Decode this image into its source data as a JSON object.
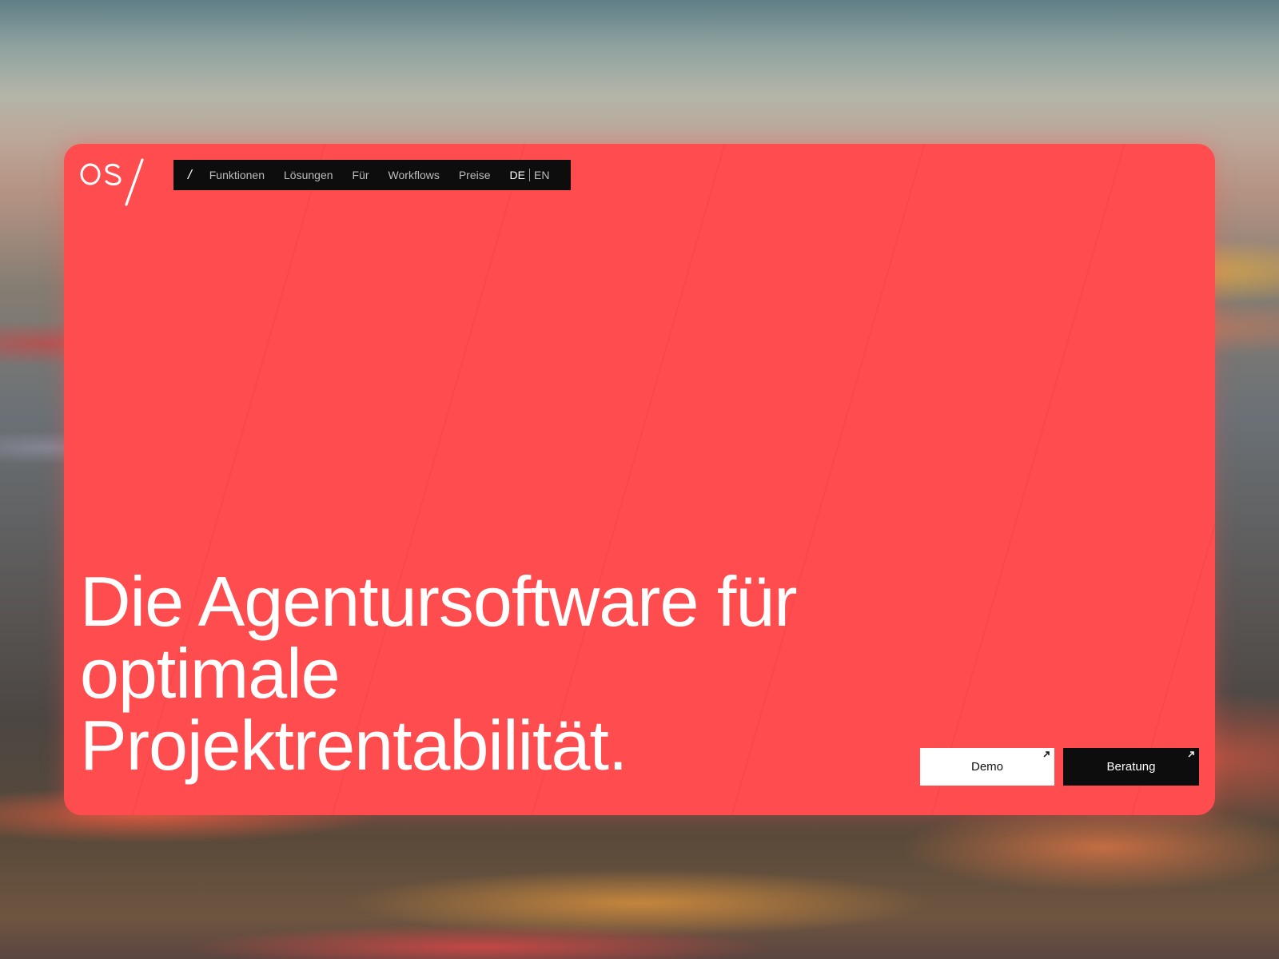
{
  "brand": {
    "logo_text": "OS/"
  },
  "nav": {
    "home_label": "/",
    "items": [
      {
        "label": "Funktionen"
      },
      {
        "label": "Lösungen"
      },
      {
        "label": "Für"
      },
      {
        "label": "Workflows"
      },
      {
        "label": "Preise"
      }
    ],
    "language": {
      "active": "DE",
      "other": "EN"
    }
  },
  "hero": {
    "headline_lines": [
      "Die Agentursoftware für",
      "optimale",
      "Projektrentabilität."
    ]
  },
  "actions": {
    "demo_label": "Demo",
    "consult_label": "Beratung"
  },
  "colors": {
    "card_background": "#ff4d4f",
    "nav_background": "#0d0d0d",
    "primary_text": "#ffffff",
    "demo_button_bg": "#ffffff",
    "consult_button_bg": "#0d0d0d"
  },
  "icons": {
    "external_link": "arrow-up-right-icon",
    "logo": "os-slash-logo"
  }
}
